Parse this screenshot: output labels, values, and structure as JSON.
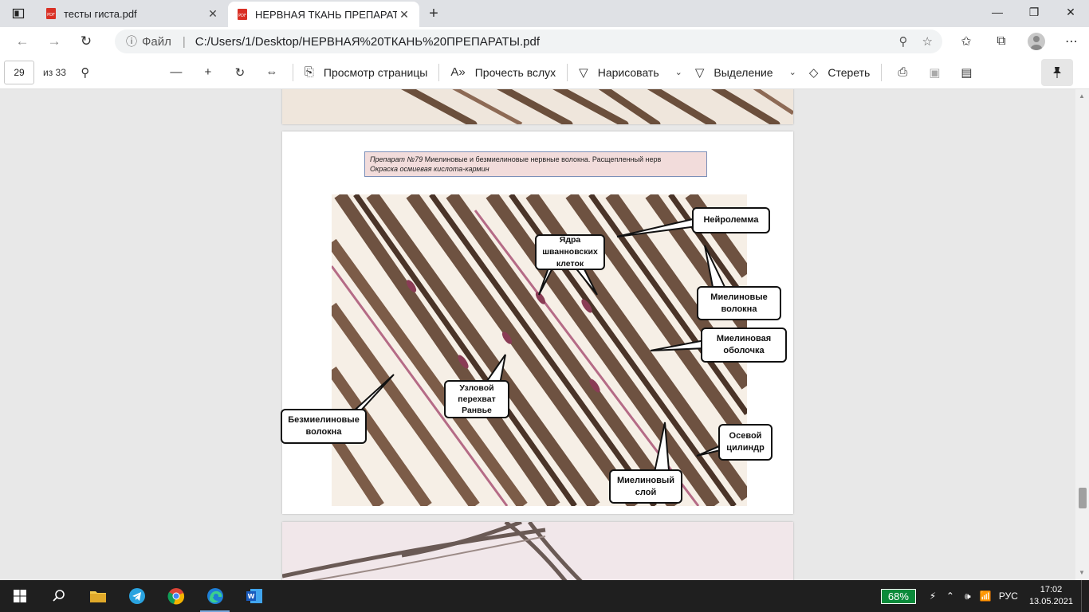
{
  "tabs": [
    {
      "title": "тесты гиста.pdf",
      "active": false
    },
    {
      "title": "НЕРВНАЯ ТКАНЬ ПРЕПАРАТЫ.pdf",
      "active": true
    }
  ],
  "address": {
    "file_label": "Файл",
    "url": "C:/Users/1/Desktop/НЕРВНАЯ%20ТКАНЬ%20ПРЕПАРАТЫ.pdf"
  },
  "pdf_toolbar": {
    "page_number": "29",
    "page_count": "из 33",
    "page_view": "Просмотр страницы",
    "read_aloud": "Прочесть вслух",
    "draw": "Нарисовать",
    "highlight": "Выделение",
    "erase": "Стереть"
  },
  "document": {
    "caption_prefix": "Препарат №79",
    "caption_main": " Миелиновые и безмиелиновые нервные волокна. Расщепленный нерв",
    "caption_stain": "Окраска осмиевая кислота-кармин",
    "labels": {
      "neurolemma": "Нейролемма",
      "schwann_nuclei": "Ядра шванновских клеток",
      "myelin_fibers": "Миелиновые волокна",
      "myelin_sheath": "Миелиновая оболочка",
      "unmyelinated_fibers": "Безмиелиновые волокна",
      "node_ranvier": "Узловой перехват Ранвье",
      "axial_cylinder": "Осевой цилиндр",
      "myelin_layer": "Миелиновый слой"
    }
  },
  "taskbar": {
    "battery": "68%",
    "language": "РУС",
    "time": "17:02",
    "date": "13.05.2021"
  }
}
